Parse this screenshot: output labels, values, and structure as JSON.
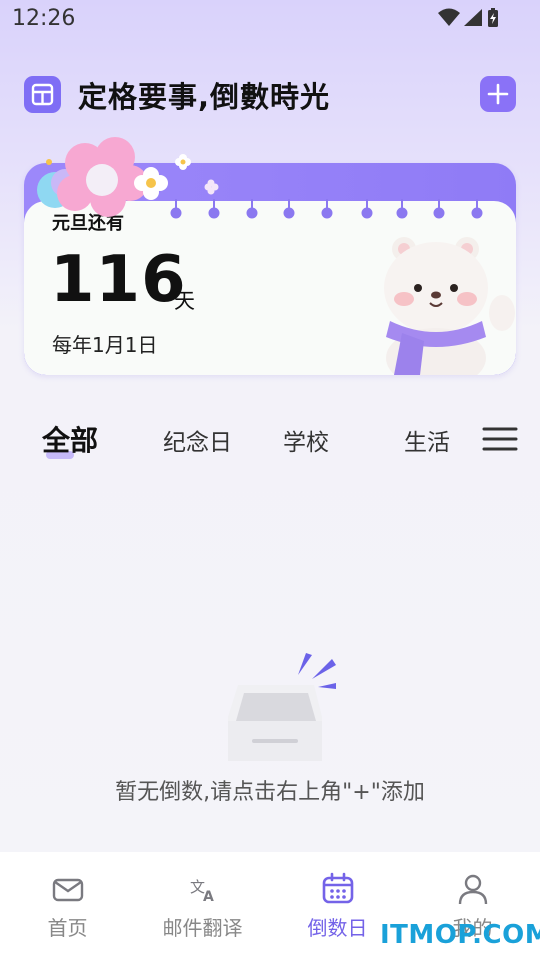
{
  "status_bar": {
    "time": "12:26"
  },
  "header": {
    "title": "定格要事,倒數時光"
  },
  "hero": {
    "label": "元旦还有",
    "days": "116",
    "unit": "天",
    "date": "每年1月1日"
  },
  "tabs": [
    {
      "label": "全部",
      "active": true
    },
    {
      "label": "纪念日",
      "active": false
    },
    {
      "label": "学校",
      "active": false
    },
    {
      "label": "生活",
      "active": false
    }
  ],
  "empty_state": {
    "text": "暂无倒数,请点击右上角\"+\"添加"
  },
  "bottom_nav": [
    {
      "label": "首页",
      "icon": "mail-icon",
      "active": false
    },
    {
      "label": "邮件翻译",
      "icon": "translate-icon",
      "active": false
    },
    {
      "label": "倒数日",
      "icon": "calendar-icon",
      "active": true
    },
    {
      "label": "我的",
      "icon": "person-icon",
      "active": false
    }
  ],
  "watermark": "ITMOP.COM",
  "colors": {
    "accent": "#7f6ef5",
    "active_nav": "#7463e8",
    "background": "#f4f4f9"
  }
}
